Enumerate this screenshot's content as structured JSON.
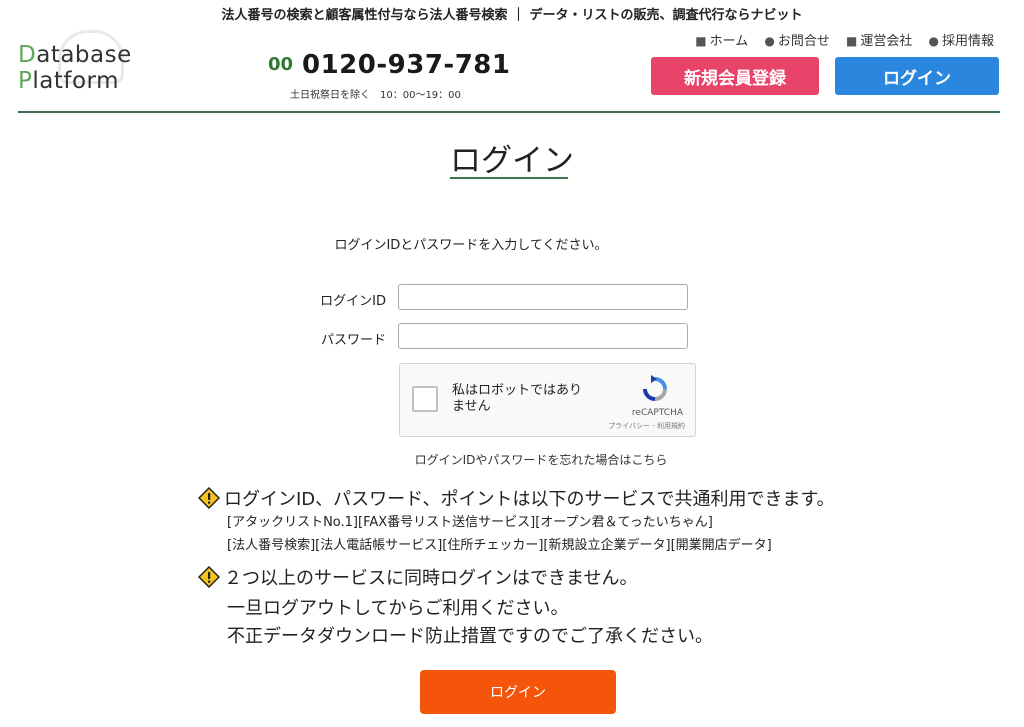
{
  "header": {
    "tagline": "法人番号の検索と顧客属性付与なら法人番号検索 ｜ データ・リストの販売、調査代行ならナビット",
    "logo": {
      "line1_accent": "D",
      "line1_rest": "atabase",
      "line2_accent": "P",
      "line2_rest": "latform"
    },
    "phone": {
      "icon": "free-dial-icon",
      "icon_text": "00",
      "number": "0120-937-781",
      "hours": "土日祝祭日を除く　10：00～19：00"
    },
    "util_nav": [
      {
        "label": "ホーム",
        "icon": "folder-icon"
      },
      {
        "label": "お問合せ",
        "icon": "chat-icon"
      },
      {
        "label": "運営会社",
        "icon": "folder-icon"
      },
      {
        "label": "採用情報",
        "icon": "chat-icon"
      }
    ],
    "register_label": "新規会員登録",
    "login_label": "ログイン",
    "colors": {
      "register": "#e8446a",
      "login": "#2b87dd",
      "rule": "#3a6d4c"
    }
  },
  "main": {
    "title": "ログイン",
    "intro": "ログインIDとパスワードを入力してください。",
    "login_id_label": "ログインID",
    "password_label": "パスワード",
    "login_id_value": "",
    "password_value": "",
    "captcha": {
      "label": "私はロボットではありません",
      "brand": "reCAPTCHA",
      "terms": "プライバシー - 利用規約"
    },
    "forgot": "ログインIDやパスワードを忘れた場合はこちら",
    "notices": [
      {
        "icon": "warning-icon",
        "heading": "ログインID、パスワード、ポイントは以下のサービスで共通利用できます。",
        "lines": [
          "[アタックリストNo.1][FAX番号リスト送信サービス][オープン君＆てったいちゃん]",
          "[法人番号検索][法人電話帳サービス][住所チェッカー][新規設立企業データ][開業開店データ]"
        ]
      },
      {
        "icon": "warning-icon",
        "heading": "２つ以上のサービスに同時ログインはできません。",
        "lines": [
          "一旦ログアウトしてからご利用ください。",
          "不正データダウンロード防止措置ですのでご了承ください。"
        ]
      }
    ],
    "submit_label": "ログイン",
    "submit_color": "#f5550a"
  }
}
